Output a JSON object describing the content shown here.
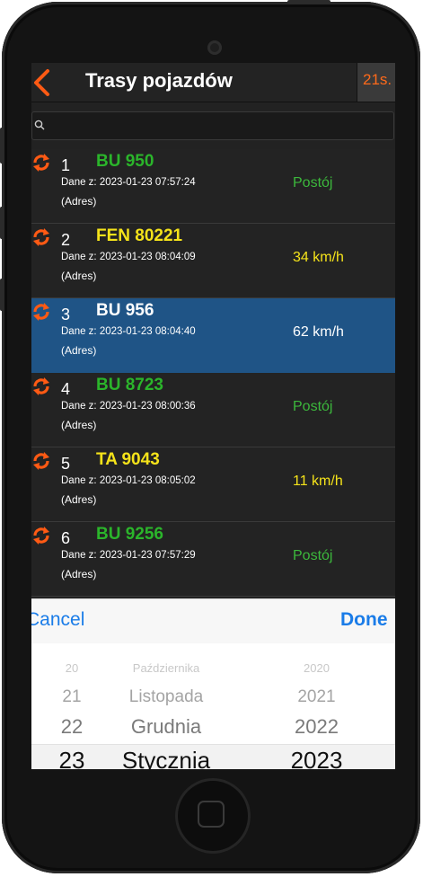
{
  "header": {
    "title": "Trasy pojazdów",
    "timer": "21s."
  },
  "search": {
    "placeholder": ""
  },
  "vehicles": [
    {
      "index": "1",
      "plate": "BU 950",
      "plate_color": "#2bb52b",
      "date": "Dane z: 2023-01-23 07:57:24",
      "address": "(Adres)",
      "status": "Postój",
      "status_color": "#3cb83c"
    },
    {
      "index": "2",
      "plate": "FEN 80221",
      "plate_color": "#f5e31a",
      "date": "Dane z: 2023-01-23 08:04:09",
      "address": "(Adres)",
      "status": "34 km/h",
      "status_color": "#f5e31a"
    },
    {
      "index": "3",
      "plate": "BU 956",
      "plate_color": "#ffffff",
      "date": "Dane z: 2023-01-23 08:04:40",
      "address": "(Adres)",
      "status": "62 km/h",
      "status_color": "#ffffff"
    },
    {
      "index": "4",
      "plate": "BU 8723",
      "plate_color": "#2bb52b",
      "date": "Dane z: 2023-01-23 08:00:36",
      "address": "(Adres)",
      "status": "Postój",
      "status_color": "#3cb83c"
    },
    {
      "index": "5",
      "plate": "TA 9043",
      "plate_color": "#f5e31a",
      "date": "Dane z: 2023-01-23 08:05:02",
      "address": "(Adres)",
      "status": "11 km/h",
      "status_color": "#f5e31a"
    },
    {
      "index": "6",
      "plate": "BU 9256",
      "plate_color": "#2bb52b",
      "date": "Dane z: 2023-01-23 07:57:29",
      "address": "(Adres)",
      "status": "Postój",
      "status_color": "#3cb83c"
    }
  ],
  "picker": {
    "cancel_label": "Cancel",
    "done_label": "Done",
    "rows": [
      {
        "day": "20",
        "month": "Października",
        "year": "2020"
      },
      {
        "day": "21",
        "month": "Listopada",
        "year": "2021"
      },
      {
        "day": "22",
        "month": "Grudnia",
        "year": "2022"
      },
      {
        "day": "23",
        "month": "Stycznia",
        "year": "2023"
      }
    ]
  },
  "colors": {
    "accent": "#ff5a14",
    "selected_row": "#1f5486",
    "ios_blue": "#1a7ce8"
  },
  "icons": {
    "back": "chevron-left-icon",
    "search": "search-icon",
    "route": "refresh-arrows-icon"
  }
}
